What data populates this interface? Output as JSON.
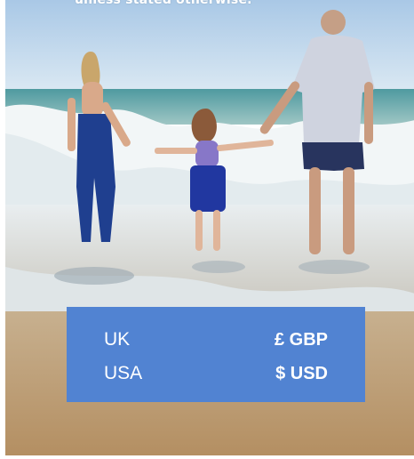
{
  "caption": {
    "text": "unless stated otherwise."
  },
  "currency_table": {
    "rows": [
      {
        "country": "UK",
        "currency": "£ GBP"
      },
      {
        "country": "USA",
        "currency": "$ USD"
      }
    ]
  },
  "colors": {
    "panel_bg": "#5183d2",
    "text": "#ffffff",
    "sky": "#b9d3ea",
    "sea": "#5f9ea5",
    "sand": "#b89770"
  }
}
